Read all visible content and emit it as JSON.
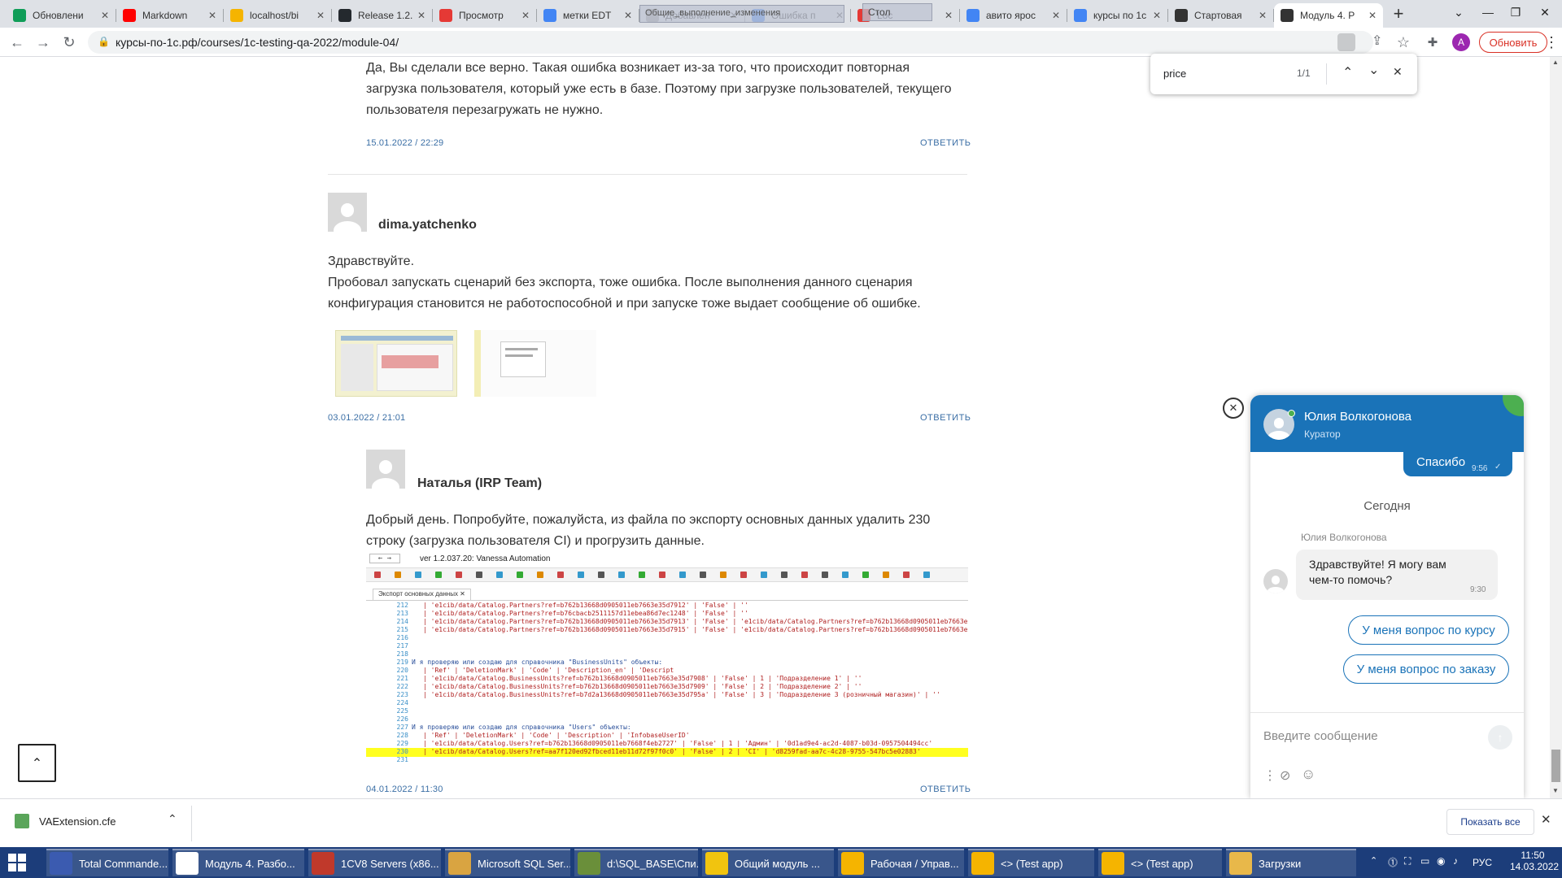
{
  "browser": {
    "tabs": [
      {
        "label": "Обновлени",
        "icon": "sheets-icon",
        "color": "#0f9d58"
      },
      {
        "label": "Markdown",
        "icon": "youtube-icon",
        "color": "#ff0000"
      },
      {
        "label": "localhost/bi",
        "icon": "1c-icon",
        "color": "#f5b400"
      },
      {
        "label": "Release 1.2.",
        "icon": "github-icon",
        "color": "#24292e"
      },
      {
        "label": "Просмотр",
        "icon": "p-icon",
        "color": "#e53935"
      },
      {
        "label": "метки EDT",
        "icon": "google-icon",
        "color": "#4285f4"
      },
      {
        "label": "Добавлен",
        "icon": "generic-icon",
        "color": "#9e9e9e"
      },
      {
        "label": "Ошибка п",
        "icon": "google-icon",
        "color": "#4285f4"
      },
      {
        "label": "Loc",
        "icon": "x-icon",
        "color": "#e53935"
      },
      {
        "label": "авито ярос",
        "icon": "google-icon",
        "color": "#4285f4"
      },
      {
        "label": "курсы по 1с",
        "icon": "google-icon",
        "color": "#4285f4"
      },
      {
        "label": "Стартовая",
        "icon": "start-icon",
        "color": "#333333"
      },
      {
        "label": "Модуль 4. Р",
        "icon": "module-icon",
        "color": "#333333"
      }
    ],
    "overlay_tooltip": "Общие_выполнение_изменения",
    "overlay_tooltip2": "Стол",
    "url": "курсы-по-1с.рф/courses/1c-testing-qa-2022/module-04/",
    "profile_letter": "A",
    "update_label": "Обновить",
    "find": {
      "query": "price",
      "count": "1/1"
    }
  },
  "comments": {
    "reply1": {
      "text_lines": [
        "Да, Вы сделали все верно. Такая ошибка возникает из-за того, что происходит повторная",
        "загрузка пользователя, который уже есть в базе. Поэтому при загрузке пользователей, текущего",
        "пользователя перезагружать не нужно."
      ],
      "date": "15.01.2022 / 22:29",
      "reply_label": "ОТВЕТИТЬ"
    },
    "comment2": {
      "author": "dima.yatchenko",
      "text_lines": [
        "Здравствуйте.",
        "Пробовал запускать сценарий без экспорта, тоже ошибка. После выполнения данного сценария",
        "конфигурация становится не работоспособной и при запуске тоже выдает сообщение об ошибке."
      ],
      "date": "03.01.2022 / 21:01",
      "reply_label": "ОТВЕТИТЬ"
    },
    "reply3": {
      "author": "Наталья (IRP Team)",
      "text_lines": [
        "Добрый день. Попробуйте, пожалуйста, из файла по экспорту основных данных удалить 230",
        "строку (загрузка пользователя CI) и прогрузить данные."
      ],
      "date": "04.01.2022 / 11:30",
      "reply_label": "ОТВЕТИТЬ"
    }
  },
  "vanessa": {
    "title": "ver 1.2.037.20: Vanessa Automation",
    "tab": "Экспорт основных данных",
    "rows": [
      {
        "n": "212",
        "t": "| 'e1cib/data/Catalog.Partners?ref=b762b13668d0905011eb7663e35d7912' | 'False'       | ''"
      },
      {
        "n": "213",
        "t": "| 'e1cib/data/Catalog.Partners?ref=b76cbacb2511157d11ebea86d7ec1248' | 'False'       | ''"
      },
      {
        "n": "214",
        "t": "| 'e1cib/data/Catalog.Partners?ref=b762b13668d0905011eb7663e35d7913' | 'False'       | 'e1cib/data/Catalog.Partners?ref=b762b13668d0905011eb7663e35d7"
      },
      {
        "n": "215",
        "t": "| 'e1cib/data/Catalog.Partners?ref=b762b13668d0905011eb7663e35d7915' | 'False'       | 'e1cib/data/Catalog.Partners?ref=b762b13668d0905011eb7663e35d7"
      },
      {
        "n": "216",
        "t": ""
      },
      {
        "n": "217",
        "t": ""
      },
      {
        "n": "218",
        "t": ""
      },
      {
        "n": "219",
        "t": "И я проверяю или создаю для справочника \"BusinessUnits\" объекты:"
      },
      {
        "n": "220",
        "t": "| 'Ref'                                                            | 'DeletionMark' | 'Code' | 'Description_en'            | 'Descript"
      },
      {
        "n": "221",
        "t": "| 'e1cib/data/Catalog.BusinessUnits?ref=b762b13668d0905011eb7663e35d7908' | 'False'  | 1      | 'Подразделение 1'           | ''"
      },
      {
        "n": "222",
        "t": "| 'e1cib/data/Catalog.BusinessUnits?ref=b762b13668d0905011eb7663e35d7909' | 'False'  | 2      | 'Подразделение 2'           | ''"
      },
      {
        "n": "223",
        "t": "| 'e1cib/data/Catalog.BusinessUnits?ref=b7d2a13668d0905011eb7663e35d795a' | 'False'  | 3      | 'Подразделение 3 (розничный магазин)' | ''"
      },
      {
        "n": "224",
        "t": ""
      },
      {
        "n": "225",
        "t": ""
      },
      {
        "n": "226",
        "t": ""
      },
      {
        "n": "227",
        "t": "И я проверяю или создаю для справочника \"Users\" объекты:"
      },
      {
        "n": "228",
        "t": "| 'Ref'                                                     | 'DeletionMark' | 'Code' | 'Description' | 'InfobaseUserID'"
      },
      {
        "n": "229",
        "t": "| 'e1cib/data/Catalog.Users?ref=b762b13668d0905011eb7668f4eb2727' | 'False' | 1 | 'Админ' | '0d1ad9e4-ac2d-4087-b03d-0957504494cc'"
      },
      {
        "n": "230",
        "t": "| 'e1cib/data/Catalog.Users?ref=aa7f120ed92fbced11eb11d72f97f0c0' | 'False' | 2 | 'CI'    | 'd8259fad-aa7c-4c28-9755-547bc5e02883'"
      },
      {
        "n": "231",
        "t": ""
      }
    ]
  },
  "chat": {
    "name": "Юлия Волкогонова",
    "role": "Куратор",
    "sent_message": "Спасибо",
    "sent_time": "9:56",
    "day_separator": "Сегодня",
    "operator_name": "Юлия Волкогонова",
    "operator_message_line1": "Здравствуйте! Я могу вам",
    "operator_message_line2": "чем-то помочь?",
    "operator_time": "9:30",
    "quick_reply_1": "У меня вопрос по курсу",
    "quick_reply_2": "У меня вопрос по заказу",
    "input_placeholder": "Введите сообщение"
  },
  "downloads": {
    "file": "VAExtension.cfe",
    "show_all": "Показать все"
  },
  "taskbar": {
    "items": [
      {
        "label": "Total Commande...",
        "color": "#3b5bb0"
      },
      {
        "label": "Модуль 4. Разбо...",
        "color": "#ffffff"
      },
      {
        "label": "1CV8 Servers (x86...",
        "color": "#c0392b"
      },
      {
        "label": "Microsoft SQL Ser...",
        "color": "#d9a441"
      },
      {
        "label": "d:\\SQL_BASE\\Спи...",
        "color": "#6a8f3a"
      },
      {
        "label": "Общий модуль ...",
        "color": "#f1c40f"
      },
      {
        "label": "Рабочая / Управ...",
        "color": "#f5b400"
      },
      {
        "label": "<> (Test app)",
        "color": "#f5b400"
      },
      {
        "label": "<> (Test app)",
        "color": "#f5b400"
      },
      {
        "label": "Загрузки",
        "color": "#e8b84a"
      }
    ],
    "lang": "РУС",
    "time": "11:50",
    "date": "14.03.2022"
  }
}
